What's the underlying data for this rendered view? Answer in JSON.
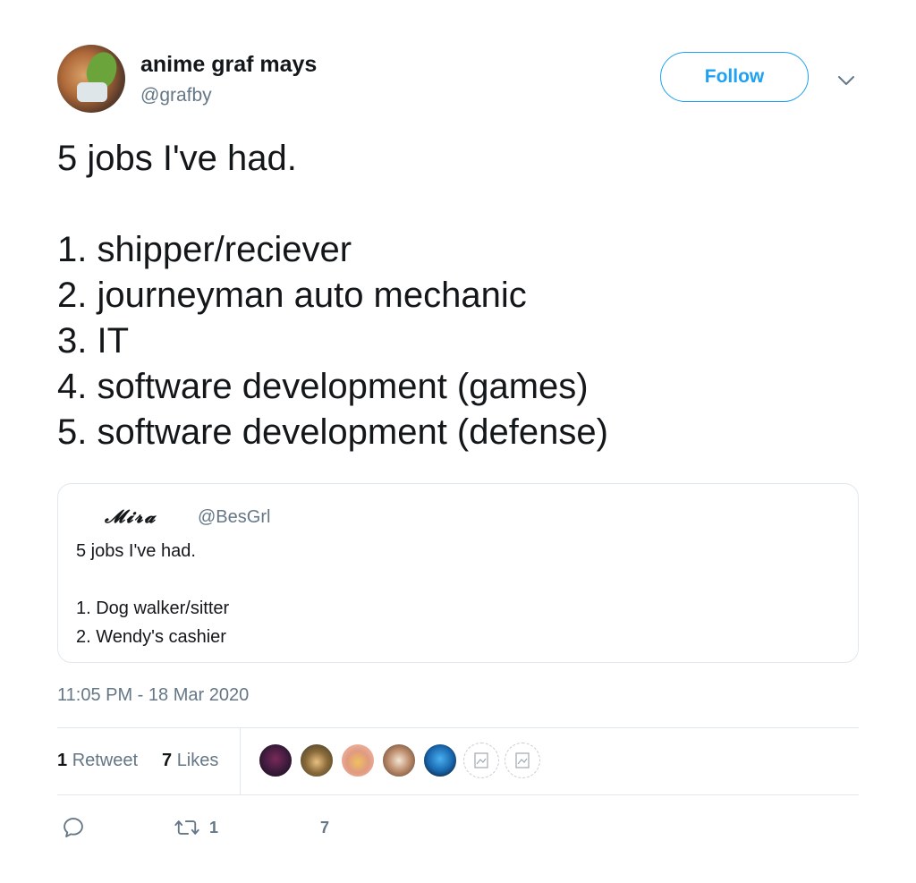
{
  "author": {
    "display_name": "anime graf mays",
    "handle": "@grafby",
    "avatar_icon": "avatar-image"
  },
  "header": {
    "follow_label": "Follow",
    "more_icon": "chevron-down-icon"
  },
  "tweet": {
    "lines": [
      "5 jobs I've had.",
      "",
      "1. shipper/reciever",
      "2. journeyman auto mechanic",
      "3. IT",
      "4. software development (games)",
      "5. software development (defense)"
    ]
  },
  "quoted_tweet": {
    "display_name": "𝓜𝓲𝓻𝓪",
    "handle": "@BesGrl",
    "lines": [
      "5 jobs I've had.",
      "",
      "1. Dog walker/sitter",
      "2. Wendy's cashier"
    ]
  },
  "timestamp": "11:05 PM - 18 Mar 2020",
  "stats": {
    "retweets_count": "1",
    "retweets_label": "Retweet",
    "likes_count": "7",
    "likes_label": "Likes"
  },
  "actions": {
    "reply_icon": "reply-icon",
    "retweet_icon": "retweet-icon",
    "retweet_count": "1",
    "like_count": "7"
  },
  "colors": {
    "accent": "#1da1f2",
    "secondary_text": "#657786",
    "border": "#e1e8ed"
  }
}
